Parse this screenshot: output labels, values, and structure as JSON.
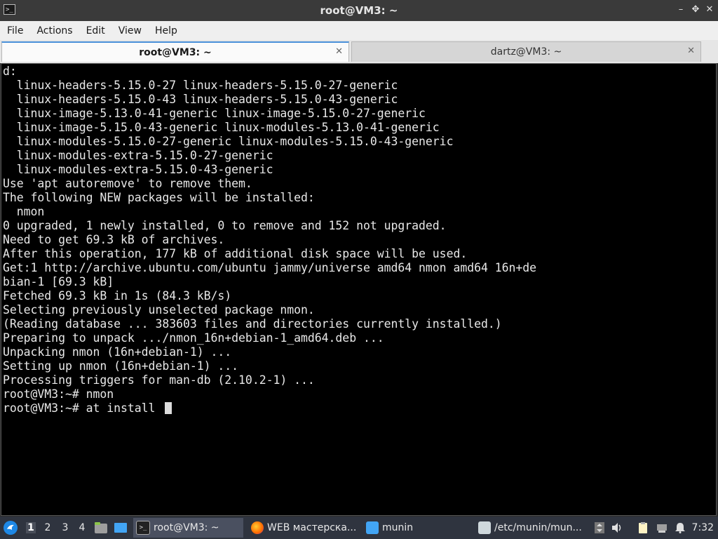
{
  "window": {
    "title": "root@VM3: ~",
    "app_icon": ">_",
    "controls": {
      "minimize": "–",
      "maximize": "✥",
      "restore": "✥",
      "close": "✕"
    }
  },
  "menu": [
    "File",
    "Actions",
    "Edit",
    "View",
    "Help"
  ],
  "tabs": [
    {
      "label": "root@VM3: ~",
      "close": "✕",
      "active": true
    },
    {
      "label": "dartz@VM3: ~",
      "close": "✕",
      "active": false
    }
  ],
  "terminal": {
    "lines": [
      "d:",
      "  linux-headers-5.15.0-27 linux-headers-5.15.0-27-generic",
      "  linux-headers-5.15.0-43 linux-headers-5.15.0-43-generic",
      "  linux-image-5.13.0-41-generic linux-image-5.15.0-27-generic",
      "  linux-image-5.15.0-43-generic linux-modules-5.13.0-41-generic",
      "  linux-modules-5.15.0-27-generic linux-modules-5.15.0-43-generic",
      "  linux-modules-extra-5.15.0-27-generic",
      "  linux-modules-extra-5.15.0-43-generic",
      "Use 'apt autoremove' to remove them.",
      "The following NEW packages will be installed:",
      "  nmon",
      "0 upgraded, 1 newly installed, 0 to remove and 152 not upgraded.",
      "Need to get 69.3 kB of archives.",
      "After this operation, 177 kB of additional disk space will be used.",
      "Get:1 http://archive.ubuntu.com/ubuntu jammy/universe amd64 nmon amd64 16n+de",
      "bian-1 [69.3 kB]",
      "Fetched 69.3 kB in 1s (84.3 kB/s)",
      "Selecting previously unselected package nmon.",
      "(Reading database ... 383603 files and directories currently installed.)",
      "Preparing to unpack .../nmon_16n+debian-1_amd64.deb ...",
      "Unpacking nmon (16n+debian-1) ...",
      "Setting up nmon (16n+debian-1) ...",
      "Processing triggers for man-db (2.10.2-1) ...",
      "root@VM3:~# nmon"
    ],
    "prompt_line": "root@VM3:~# at install "
  },
  "taskbar": {
    "workspaces": [
      "1",
      "2",
      "3",
      "4"
    ],
    "active_workspace": "1",
    "tasks": [
      {
        "label": "root@VM3: ~",
        "icon": "terminal-icon"
      },
      {
        "label": "WEB мастерска...",
        "icon": "firefox-icon"
      },
      {
        "label": "munin",
        "icon": "folder-icon"
      },
      {
        "label": "/etc/munin/mun...",
        "icon": "text-editor-icon"
      }
    ],
    "clock": "7:32",
    "colors": {
      "bar": "#2f343f",
      "accent": "#4a90d9"
    }
  }
}
